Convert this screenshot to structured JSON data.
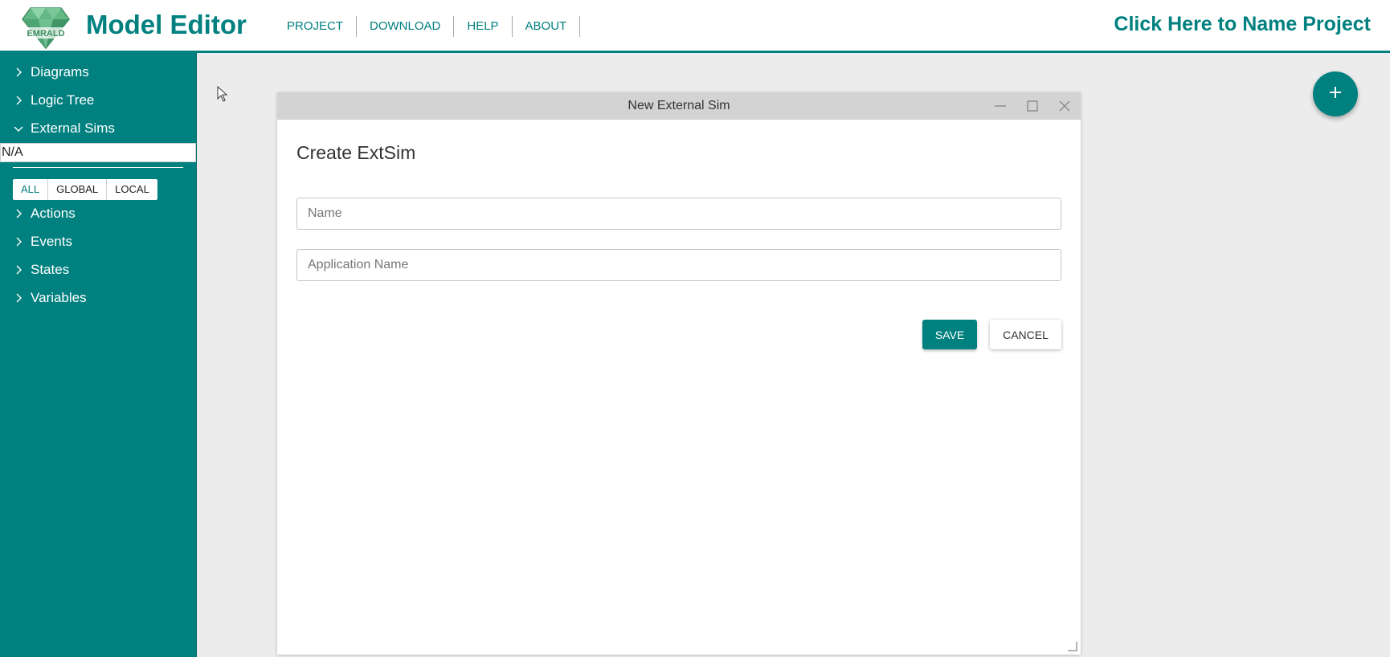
{
  "header": {
    "logo_text": "EMRALD",
    "app_title": "Model Editor",
    "nav": [
      "PROJECT",
      "DOWNLOAD",
      "HELP",
      "ABOUT"
    ],
    "project_name": "Click Here to Name Project"
  },
  "sidebar": {
    "items_top": [
      {
        "label": "Diagrams",
        "expanded": false
      },
      {
        "label": "Logic Tree",
        "expanded": false
      },
      {
        "label": "External Sims",
        "expanded": true
      }
    ],
    "search_value": "N/A",
    "filters": [
      "ALL",
      "GLOBAL",
      "LOCAL"
    ],
    "active_filter": "ALL",
    "items_bottom": [
      {
        "label": "Actions",
        "expanded": false
      },
      {
        "label": "Events",
        "expanded": false
      },
      {
        "label": "States",
        "expanded": false
      },
      {
        "label": "Variables",
        "expanded": false
      }
    ]
  },
  "dialog": {
    "window_title": "New External Sim",
    "heading": "Create ExtSim",
    "name_placeholder": "Name",
    "app_name_placeholder": "Application Name",
    "save_label": "SAVE",
    "cancel_label": "CANCEL"
  },
  "icons": {
    "fab": "plus-icon",
    "collapsed": "chevron-right-icon",
    "expanded": "chevron-down-icon"
  },
  "colors": {
    "accent": "#00807f",
    "titlebar": "#d3d3d3",
    "background": "#ececec"
  }
}
